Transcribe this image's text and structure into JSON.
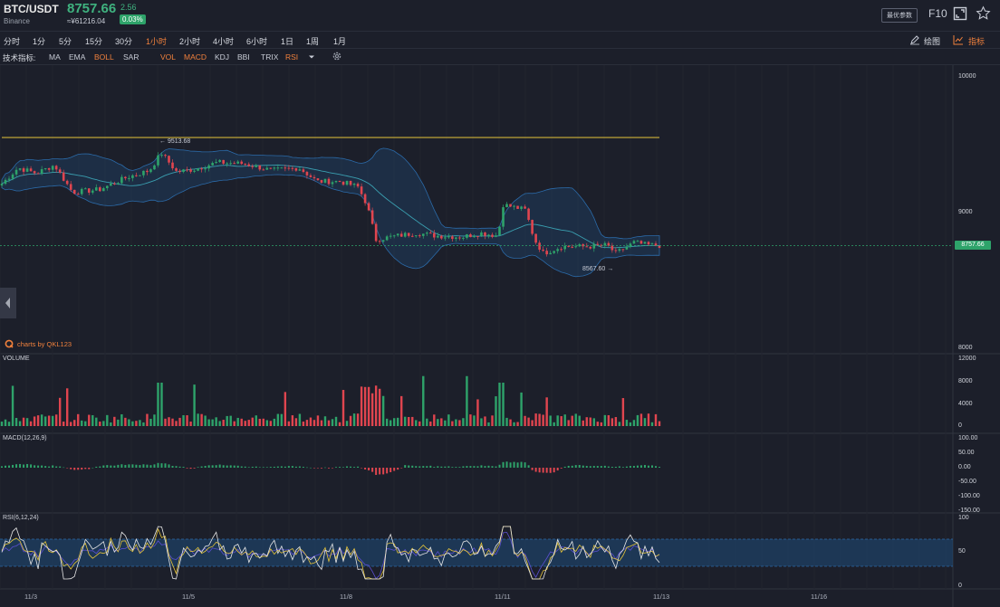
{
  "header": {
    "pair": "BTC/USDT",
    "exchange": "Binance",
    "price": "8757.66",
    "change": "2.56",
    "cny_price": "≈¥61216.04",
    "change_pct": "0.03%",
    "settings_label": "最优参数",
    "f10_label": "F10",
    "icons": {
      "fullscreen": "fullscreen-icon",
      "favorite": "star-icon"
    }
  },
  "timeframes": [
    {
      "label": "分时",
      "active": false
    },
    {
      "label": "1分",
      "active": false
    },
    {
      "label": "5分",
      "active": false
    },
    {
      "label": "15分",
      "active": false
    },
    {
      "label": "30分",
      "active": false
    },
    {
      "label": "1小时",
      "active": true
    },
    {
      "label": "2小时",
      "active": false
    },
    {
      "label": "4小时",
      "active": false
    },
    {
      "label": "6小时",
      "active": false
    },
    {
      "label": "1日",
      "active": false
    },
    {
      "label": "1周",
      "active": false
    },
    {
      "label": "1月",
      "active": false
    }
  ],
  "tools": {
    "draw_label": "绘图",
    "indicator_label": "指标"
  },
  "indicators": {
    "title": "技术指标:",
    "items": [
      {
        "label": "MA",
        "active": false
      },
      {
        "label": "EMA",
        "active": false
      },
      {
        "label": "BOLL",
        "active": true
      },
      {
        "label": "SAR",
        "active": false
      },
      {
        "label": "VOL",
        "active": true
      },
      {
        "label": "MACD",
        "active": true
      },
      {
        "label": "KDJ",
        "active": false
      },
      {
        "label": "BBI",
        "active": false
      },
      {
        "label": "TRIX",
        "active": false
      },
      {
        "label": "RSI",
        "active": true
      }
    ]
  },
  "chart": {
    "watermark": "charts by QKL123",
    "high_annotation": "← 9513.68",
    "low_annotation": "8567.60 →",
    "price_tag": "8757.66",
    "price_axis": [
      "10000",
      "9000",
      "8000"
    ],
    "volume_title": "VOLUME",
    "volume_axis": [
      "12000",
      "8000",
      "4000",
      "0"
    ],
    "macd_title": "MACD(12,26,9)",
    "macd_axis": [
      "100.00",
      "50.00",
      "0.00",
      "-50.00",
      "-100.00",
      "-150.00"
    ],
    "rsi_title": "RSI(6,12,24)",
    "rsi_axis": [
      "100",
      "50",
      "0"
    ],
    "x_labels": [
      "11/3",
      "11/5",
      "11/8",
      "11/11",
      "11/13",
      "11/16"
    ],
    "colors": {
      "up": "#2ea36a",
      "down": "#e0454f",
      "band": "#2b6aa8",
      "mid": "#3a9fb0",
      "dif": "#e6c43a",
      "dea": "#2a8fd6",
      "rsi6": "#e6e6e6",
      "rsi12": "#e6c43a",
      "rsi24": "#5b4fd0"
    }
  },
  "chart_data": {
    "type": "candlestick",
    "interval": "1h",
    "y_range": [
      8000,
      10000
    ],
    "anchors": [
      [
        0,
        9200
      ],
      [
        20,
        9330
      ],
      [
        40,
        9290
      ],
      [
        60,
        9350
      ],
      [
        80,
        9150
      ],
      [
        110,
        9170
      ],
      [
        140,
        9260
      ],
      [
        165,
        9310
      ],
      [
        178,
        9440
      ],
      [
        195,
        9300
      ],
      [
        215,
        9320
      ],
      [
        240,
        9370
      ],
      [
        270,
        9360
      ],
      [
        300,
        9310
      ],
      [
        330,
        9330
      ],
      [
        350,
        9230
      ],
      [
        375,
        9230
      ],
      [
        395,
        9190
      ],
      [
        405,
        9060
      ],
      [
        415,
        8800
      ],
      [
        430,
        8820
      ],
      [
        460,
        8850
      ],
      [
        480,
        8830
      ],
      [
        510,
        8820
      ],
      [
        530,
        8850
      ],
      [
        550,
        8830
      ],
      [
        555,
        9060
      ],
      [
        580,
        9020
      ],
      [
        590,
        8800
      ],
      [
        600,
        8700
      ],
      [
        620,
        8750
      ],
      [
        650,
        8750
      ],
      [
        670,
        8760
      ],
      [
        680,
        8700
      ],
      [
        700,
        8780
      ],
      [
        715,
        8760
      ],
      [
        730,
        8757
      ]
    ],
    "high": 9513.68,
    "low": 8567.6,
    "last": 8757.66
  }
}
